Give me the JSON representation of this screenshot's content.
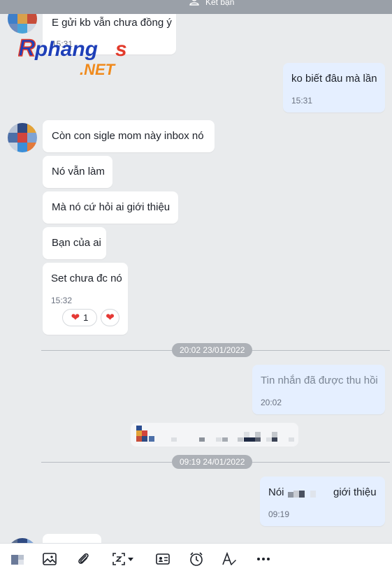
{
  "top_bar": {
    "label": "Kết bạn"
  },
  "watermark": {
    "text": "Rphangs",
    "net": ".NET"
  },
  "messages": {
    "m1": {
      "text": "E gửi kb vẫn chưa đồng ý",
      "time": "15:31"
    },
    "m2": {
      "text": "ko biết đâu mà lần",
      "time": "15:31"
    },
    "m3": {
      "text": "Còn con sigle mom này inbox nó"
    },
    "m4": {
      "text": "Nó vẫn làm"
    },
    "m5": {
      "text": "Mà nó cứ hỏi ai giới thiệu"
    },
    "m6": {
      "text": "Bạn của ai"
    },
    "m7": {
      "text": "Set chưa đc nó",
      "time": "15:32"
    },
    "reactions": {
      "heart_count": "1"
    },
    "date1": "20:02 23/01/2022",
    "m8": {
      "text": "Tin nhắn đã được thu hồi",
      "time": "20:02"
    },
    "date2": "09:19 24/01/2022",
    "m9": {
      "text_before": "Nói",
      "text_after": "giới thiệu",
      "time": "09:19"
    }
  },
  "toolbar": {
    "icons": [
      "sticker-icon",
      "image-icon",
      "attachment-icon",
      "screenshot-icon",
      "contact-card-icon",
      "reminder-icon",
      "text-format-icon",
      "more-icon"
    ]
  },
  "colors": {
    "background": "#e9ebed",
    "my_bubble": "#e5efff",
    "their_bubble": "#ffffff",
    "divider_pill": "#adb1b7"
  }
}
